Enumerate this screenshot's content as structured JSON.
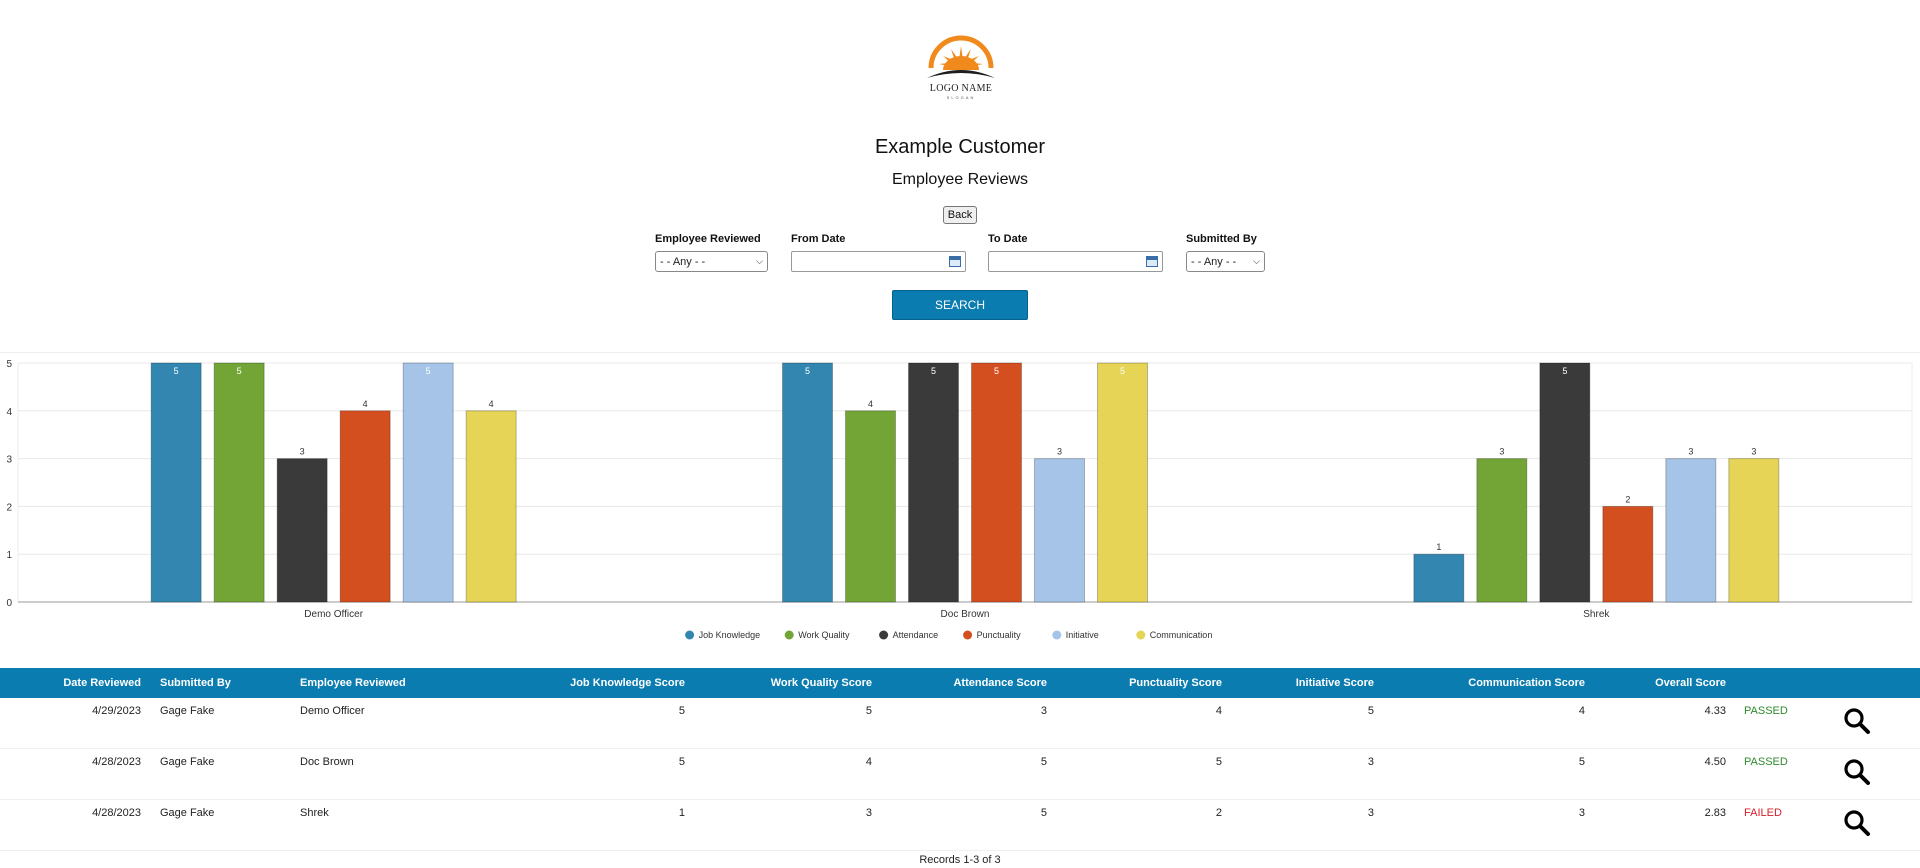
{
  "logo": {
    "name": "LOGO NAME",
    "slogan": "SLOGAN"
  },
  "customer_name": "Example Customer",
  "page_title": "Employee Reviews",
  "back_label": "Back",
  "filters": {
    "employee_reviewed": {
      "label": "Employee Reviewed",
      "value": "- - Any - -"
    },
    "from_date": {
      "label": "From Date",
      "value": ""
    },
    "to_date": {
      "label": "To Date",
      "value": ""
    },
    "submitted_by": {
      "label": "Submitted By",
      "value": "- - Any - -"
    }
  },
  "search_label": "SEARCH",
  "colors": {
    "accent": "#0a7cb0",
    "job_knowledge": "#3286b0",
    "work_quality": "#72a536",
    "attendance": "#3a3a3a",
    "punctuality": "#d44f1f",
    "initiative": "#a6c4e8",
    "communication": "#e5d455",
    "passed": "#2f8a2f",
    "failed": "#d2202a"
  },
  "chart_data": {
    "type": "bar",
    "categories": [
      "Demo Officer",
      "Doc Brown",
      "Shrek"
    ],
    "series": [
      {
        "name": "Job Knowledge",
        "values": [
          5,
          5,
          1
        ]
      },
      {
        "name": "Work Quality",
        "values": [
          5,
          4,
          3
        ]
      },
      {
        "name": "Attendance",
        "values": [
          3,
          5,
          5
        ]
      },
      {
        "name": "Punctuality",
        "values": [
          4,
          5,
          2
        ]
      },
      {
        "name": "Initiative",
        "values": [
          5,
          3,
          3
        ]
      },
      {
        "name": "Communication",
        "values": [
          4,
          5,
          3
        ]
      }
    ],
    "ylim": [
      0,
      5
    ],
    "yticks": [
      "0",
      "1",
      "2",
      "3",
      "4",
      "5"
    ],
    "legend": "bottom",
    "grid": true
  },
  "table": {
    "headers": [
      "Date Reviewed",
      "Submitted By",
      "Employee Reviewed",
      "Job Knowledge Score",
      "Work Quality Score",
      "Attendance Score",
      "Punctuality Score",
      "Initiative Score",
      "Communication Score",
      "Overall Score"
    ],
    "rows": [
      {
        "date": "4/29/2023",
        "submitted_by": "Gage Fake",
        "employee": "Demo Officer",
        "job_knowledge": "5",
        "work_quality": "5",
        "attendance": "3",
        "punctuality": "4",
        "initiative": "5",
        "communication": "4",
        "overall": "4.33",
        "status": "PASSED"
      },
      {
        "date": "4/28/2023",
        "submitted_by": "Gage Fake",
        "employee": "Doc Brown",
        "job_knowledge": "5",
        "work_quality": "4",
        "attendance": "5",
        "punctuality": "5",
        "initiative": "3",
        "communication": "5",
        "overall": "4.50",
        "status": "PASSED"
      },
      {
        "date": "4/28/2023",
        "submitted_by": "Gage Fake",
        "employee": "Shrek",
        "job_knowledge": "1",
        "work_quality": "3",
        "attendance": "5",
        "punctuality": "2",
        "initiative": "3",
        "communication": "3",
        "overall": "2.83",
        "status": "FAILED"
      }
    ]
  },
  "records_text": "Records 1-3 of 3"
}
